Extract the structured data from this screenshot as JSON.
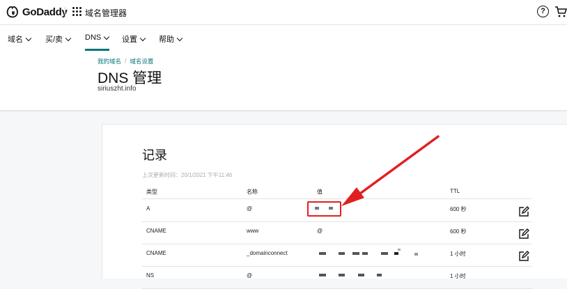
{
  "topbar": {
    "brand": "GoDaddy",
    "product": "域名管理器",
    "help_glyph": "?"
  },
  "nav": {
    "items": [
      {
        "label": "域名"
      },
      {
        "label": "买/卖"
      },
      {
        "label": "DNS"
      },
      {
        "label": "设置"
      },
      {
        "label": "帮助"
      }
    ],
    "active": "DNS"
  },
  "header": {
    "breadcrumb": [
      "我的域名",
      "域名设置"
    ],
    "breadcrumb_sep": "/",
    "title": "DNS 管理",
    "domain": "siriuszht.info"
  },
  "records": {
    "title": "记录",
    "updated": "上次更新时间：20/1/2021 下午11:46",
    "columns": [
      "类型",
      "名称",
      "值",
      "TTL"
    ],
    "rows": [
      {
        "type": "A",
        "name": "@",
        "value": "",
        "ttl": "600 秒"
      },
      {
        "type": "CNAME",
        "name": "www",
        "value": "@",
        "ttl": "600 秒"
      },
      {
        "type": "CNAME",
        "name": "_domainconnect",
        "value": "",
        "ttl": "1 小时"
      },
      {
        "type": "NS",
        "name": "@",
        "value": "",
        "ttl": "1 小时"
      }
    ]
  },
  "colors": {
    "accent": "#09757a",
    "highlight": "#e02020"
  }
}
